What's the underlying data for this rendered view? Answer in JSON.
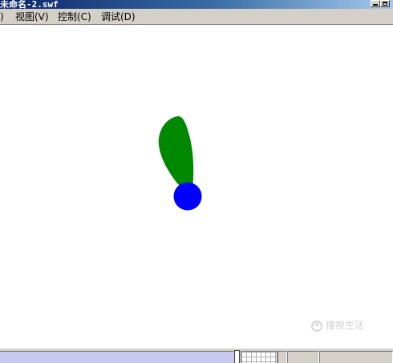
{
  "window": {
    "title": "未命名-2.swf"
  },
  "menubar": {
    "items": [
      {
        "label": ")"
      },
      {
        "label": "视图(V)"
      },
      {
        "label": "控制(C)"
      },
      {
        "label": "调试(D)"
      }
    ]
  },
  "stage": {
    "pendulum_bob_color": "#0000ff",
    "pendulum_arm_color": "#008800"
  },
  "watermark": {
    "text": "懂视生活"
  },
  "colors": {
    "title_start": "#0a246a",
    "title_end": "#a6caf0",
    "chrome": "#d4d0c8",
    "timeline": "#c8c8f0"
  }
}
